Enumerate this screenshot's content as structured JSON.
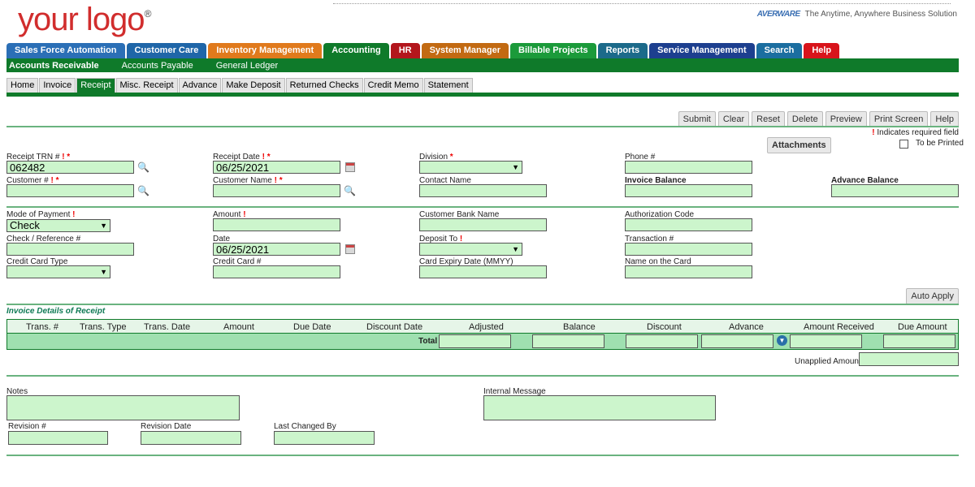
{
  "logo": {
    "text": "your logo",
    "reg": "®"
  },
  "brand": {
    "mark": "AVERWARE",
    "tagline": "The Anytime, Anywhere Business Solution"
  },
  "modules": [
    {
      "label": "Sales Force Automation",
      "color": "#2b6fb6"
    },
    {
      "label": "Customer Care",
      "color": "#1f66a8"
    },
    {
      "label": "Inventory Management",
      "color": "#e07a1c"
    },
    {
      "label": "Accounting",
      "color": "#0f7a2a"
    },
    {
      "label": "HR",
      "color": "#b3161c"
    },
    {
      "label": "System Manager",
      "color": "#c26a12"
    },
    {
      "label": "Billable Projects",
      "color": "#1b9a3a"
    },
    {
      "label": "Reports",
      "color": "#1c6a8a"
    },
    {
      "label": "Service Management",
      "color": "#1d3f8f"
    },
    {
      "label": "Search",
      "color": "#1b6ea0"
    },
    {
      "label": "Help",
      "color": "#d8141b"
    }
  ],
  "submenu": [
    "Accounts Receivable",
    "Accounts Payable",
    "General Ledger"
  ],
  "pagetabs": [
    "Home",
    "Invoice",
    "Receipt",
    "Misc. Receipt",
    "Advance",
    "Make Deposit",
    "Returned Checks",
    "Credit Memo",
    "Statement"
  ],
  "toolbar": [
    "Submit",
    "Clear",
    "Reset",
    "Delete",
    "Preview",
    "Print Screen",
    "Help"
  ],
  "required_note": "Indicates required field",
  "attachments": "Attachments",
  "to_be_printed": "To be Printed",
  "fields": {
    "receipt_trn_label": "Receipt TRN #",
    "receipt_trn_value": "062482",
    "receipt_date_label": "Receipt Date",
    "receipt_date_value": "06/25/2021",
    "division_label": "Division",
    "phone_label": "Phone #",
    "customer_no_label": "Customer #",
    "customer_name_label": "Customer Name",
    "contact_name_label": "Contact Name",
    "invoice_balance_label": "Invoice Balance",
    "advance_balance_label": "Advance Balance",
    "mode_payment_label": "Mode of Payment",
    "mode_payment_value": "Check",
    "amount_label": "Amount",
    "customer_bank_label": "Customer Bank Name",
    "authorization_label": "Authorization Code",
    "check_ref_label": "Check / Reference #",
    "date_label": "Date",
    "date_value": "06/25/2021",
    "deposit_to_label": "Deposit To",
    "transaction_label": "Transaction #",
    "cc_type_label": "Credit Card Type",
    "cc_no_label": "Credit Card #",
    "card_expiry_label": "Card Expiry Date (MMYY)",
    "name_on_card_label": "Name on the Card"
  },
  "auto_apply": "Auto Apply",
  "invoice_details_title": "Invoice Details of Receipt",
  "columns": [
    "Trans. #",
    "Trans. Type",
    "Trans. Date",
    "Amount",
    "Due Date",
    "Discount Date",
    "Adjusted",
    "Balance",
    "Discount",
    "Advance",
    "Amount Received",
    "Due Amount"
  ],
  "total_label": "Total",
  "unapplied_label": "Unapplied Amount",
  "notes_label": "Notes",
  "internal_message_label": "Internal Message",
  "revision_label": "Revision #",
  "revision_date_label": "Revision Date",
  "last_changed_label": "Last Changed By"
}
